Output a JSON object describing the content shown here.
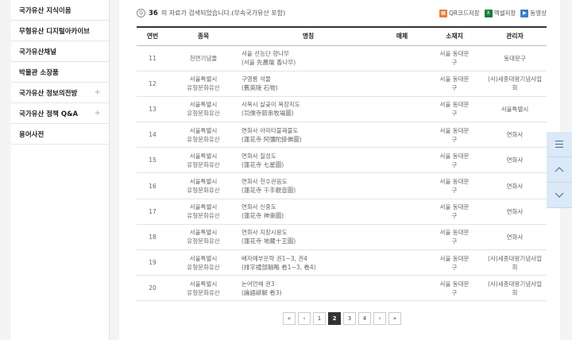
{
  "sidebar": {
    "items": [
      {
        "label": "국가유산 지식이음",
        "plus": ""
      },
      {
        "label": "무형유산 디지털아카이브",
        "plus": ""
      },
      {
        "label": "국가유산채널",
        "plus": ""
      },
      {
        "label": "박물관 소장품",
        "plus": ""
      },
      {
        "label": "국가유산 정보의전방",
        "plus": "+"
      },
      {
        "label": "국가유산 정책 Q&A",
        "plus": "+"
      },
      {
        "label": "용어사전",
        "plus": ""
      }
    ]
  },
  "result": {
    "count": "36",
    "text": "의 자료가 검색되었습니다.(부속국가유산 포함)"
  },
  "tools": {
    "qr": "QR코드저장",
    "excel": "엑셀저장",
    "video": "동영상"
  },
  "table": {
    "headers": [
      "연번",
      "종목",
      "명칭",
      "매체",
      "소재지",
      "관리자"
    ],
    "rows": [
      {
        "no": "11",
        "type1": "천연기념물",
        "type2": "",
        "name1": "서울 선농단 향나무",
        "name2": "(서울 先農壇 香나무)",
        "loc1": "서울 동대문",
        "loc2": "구",
        "mgr1": "동대문구",
        "mgr2": ""
      },
      {
        "no": "12",
        "type1": "서울특별시",
        "type2": "유형문화유산",
        "name1": "구영릉 석물",
        "name2": "(舊英陵 石物)",
        "loc1": "서울 동대문",
        "loc2": "구",
        "mgr1": "(사)세종대왕기념사업",
        "mgr2": "회"
      },
      {
        "no": "13",
        "type1": "서울특별시",
        "type2": "유형문화유산",
        "name1": "사복시 살곶이 목장지도",
        "name2": "(司僕寺箭串牧場圖)",
        "loc1": "서울 동대문",
        "loc2": "구",
        "mgr1": "서울특별시",
        "mgr2": ""
      },
      {
        "no": "14",
        "type1": "서울특별시",
        "type2": "유형문화유산",
        "name1": "연화사 아미타불괘불도",
        "name2": "(蓮花寺 阿彌陀掛佛圖)",
        "loc1": "서울 동대문",
        "loc2": "구",
        "mgr1": "연화사",
        "mgr2": ""
      },
      {
        "no": "15",
        "type1": "서울특별시",
        "type2": "유형문화유산",
        "name1": "연화사 칠성도",
        "name2": "(蓮花寺 七星圖)",
        "loc1": "서울 동대문",
        "loc2": "구",
        "mgr1": "연화사",
        "mgr2": ""
      },
      {
        "no": "16",
        "type1": "서울특별시",
        "type2": "유형문화유산",
        "name1": "연화사 천수관음도",
        "name2": "(蓮花寺 千手觀音圖)",
        "loc1": "서울 동대문",
        "loc2": "구",
        "mgr1": "연화사",
        "mgr2": ""
      },
      {
        "no": "17",
        "type1": "서울특별시",
        "type2": "유형문화유산",
        "name1": "연화사 신중도",
        "name2": "(蓮花寺 神衆圖)",
        "loc1": "서울 동대문",
        "loc2": "구",
        "mgr1": "연화사",
        "mgr2": ""
      },
      {
        "no": "18",
        "type1": "서울특별시",
        "type2": "유형문화유산",
        "name1": "연화사 지장시왕도",
        "name2": "(蓮花寺 地藏十王圖)",
        "loc1": "서울 동대문",
        "loc2": "구",
        "mgr1": "연화사",
        "mgr2": ""
      },
      {
        "no": "19",
        "type1": "서울특별시",
        "type2": "유형문화유산",
        "name1": "배자예부운략 권1~3, 권4",
        "name2": "(排字禮部韻略 卷1~3, 卷4)",
        "loc1": "서울 동대문",
        "loc2": "구",
        "mgr1": "(사)세종대왕기념사업",
        "mgr2": "회"
      },
      {
        "no": "20",
        "type1": "서울특별시",
        "type2": "유형문화유산",
        "name1": "논어언해 권3",
        "name2": "(論語諺解 卷3)",
        "loc1": "서울 동대문",
        "loc2": "구",
        "mgr1": "(사)세종대왕기념사업",
        "mgr2": "회"
      }
    ]
  },
  "pager": {
    "first": "«",
    "prev": "‹",
    "pages": [
      "1",
      "2",
      "3",
      "4"
    ],
    "current": "2",
    "next": "›",
    "last": "»"
  },
  "float_nav": {
    "menu_icon": "menu-icon",
    "up_icon": "chevron-up-icon",
    "down_icon": "chevron-down-icon"
  }
}
